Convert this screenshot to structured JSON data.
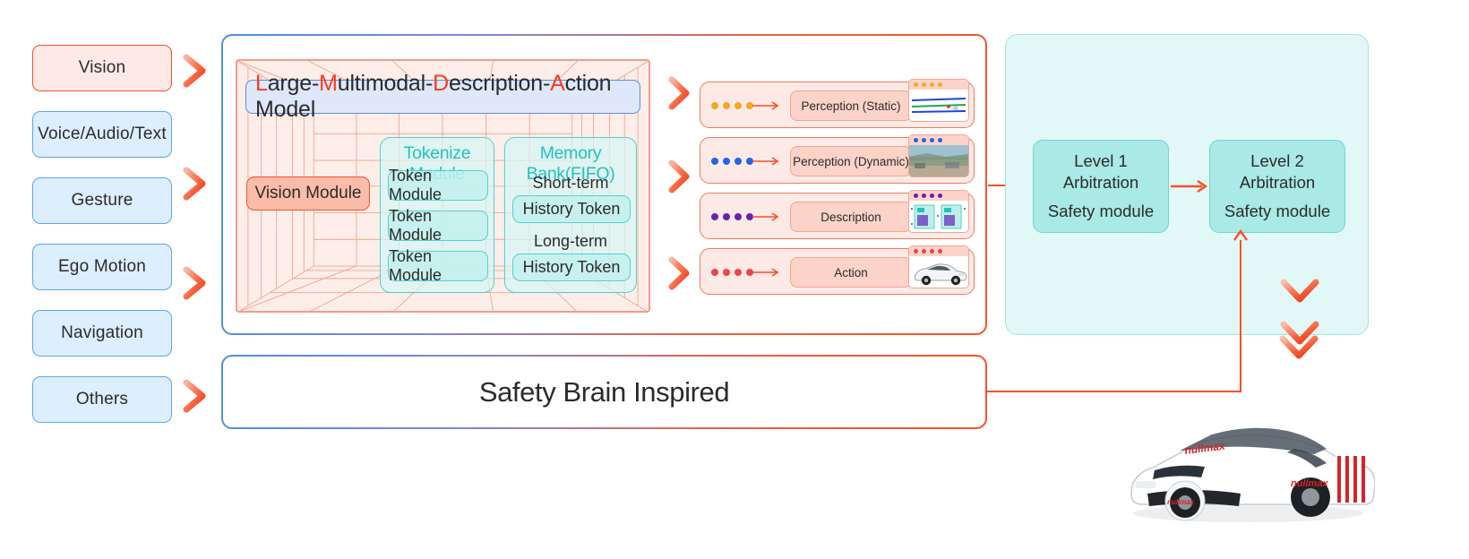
{
  "inputs": [
    {
      "label": "Vision",
      "style": "red"
    },
    {
      "label": "Voice/Audio/Text",
      "style": "blue"
    },
    {
      "label": "Gesture",
      "style": "blue"
    },
    {
      "label": "Ego Motion",
      "style": "blue"
    },
    {
      "label": "Navigation",
      "style": "blue"
    },
    {
      "label": "Others",
      "style": "blue"
    }
  ],
  "model": {
    "title_parts": [
      {
        "t": "L",
        "hl": true
      },
      {
        "t": "arge-",
        "hl": false
      },
      {
        "t": "M",
        "hl": true
      },
      {
        "t": "ultimodal-",
        "hl": false
      },
      {
        "t": "D",
        "hl": true
      },
      {
        "t": "escription-",
        "hl": false
      },
      {
        "t": "A",
        "hl": true
      },
      {
        "t": "ction Model",
        "hl": false
      }
    ],
    "title_plain": "Large-Multimodal-Description-Action Model",
    "vision_module": "Vision Module",
    "tokenize": {
      "title": "Tokenize Module",
      "items": [
        "Token Module",
        "Token Module",
        "Token Module"
      ]
    },
    "memory": {
      "title": "Memory Bank(FIFO)",
      "short_label": "Short-term",
      "short_chip": "History Token",
      "long_label": "Long-term",
      "long_chip": "History Token"
    }
  },
  "outputs": [
    {
      "label": "Perception (Static)",
      "dot_color": "#f5a623",
      "thumb": "road-lanes-thumbnail"
    },
    {
      "label": "Perception (Dynamic)",
      "dot_color": "#2563eb",
      "thumb": "road-scene-photo-thumbnail"
    },
    {
      "label": "Description",
      "dot_color": "#6b21a8",
      "thumb": "document-cards-thumbnail"
    },
    {
      "label": "Action",
      "dot_color": "#ef4444",
      "thumb": "white-car-thumbnail"
    }
  ],
  "arbitration": {
    "boxes": [
      {
        "line1": "Level 1",
        "line2": "Arbitration",
        "line3": "Safety module"
      },
      {
        "line1": "Level 2",
        "line2": "Arbitration",
        "line3": "Safety module"
      }
    ]
  },
  "safety_bar": {
    "label": "Safety Brain Inspired"
  },
  "vehicle": {
    "brand": "nullmax"
  },
  "colors": {
    "accent_red": "#fa4f28",
    "accent_blue": "#4a90e2",
    "teal": "#4fd4cd",
    "teal_fill": "#a9e9e6",
    "pink_fill": "#fdeae6"
  }
}
